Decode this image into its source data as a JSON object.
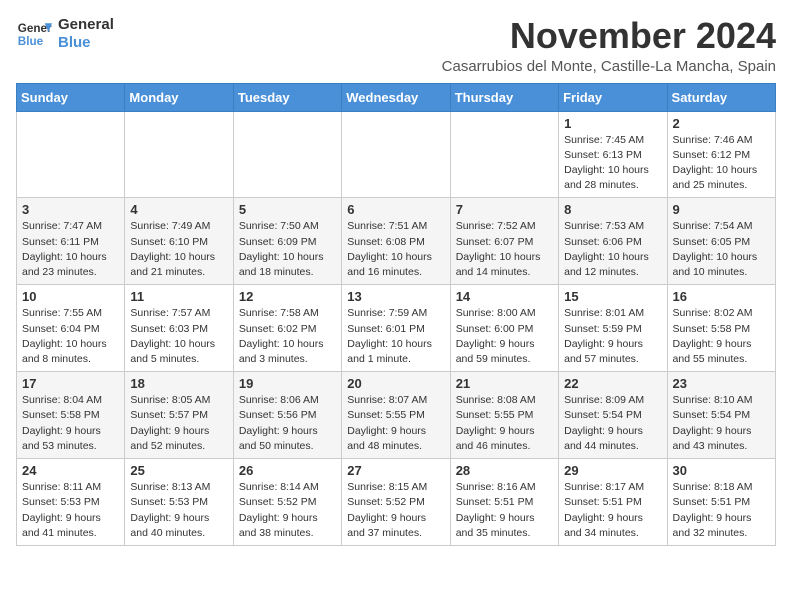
{
  "header": {
    "logo_line1": "General",
    "logo_line2": "Blue",
    "month_title": "November 2024",
    "location": "Casarrubios del Monte, Castille-La Mancha, Spain"
  },
  "days_of_week": [
    "Sunday",
    "Monday",
    "Tuesday",
    "Wednesday",
    "Thursday",
    "Friday",
    "Saturday"
  ],
  "weeks": [
    [
      {
        "day": "",
        "info": ""
      },
      {
        "day": "",
        "info": ""
      },
      {
        "day": "",
        "info": ""
      },
      {
        "day": "",
        "info": ""
      },
      {
        "day": "",
        "info": ""
      },
      {
        "day": "1",
        "info": "Sunrise: 7:45 AM\nSunset: 6:13 PM\nDaylight: 10 hours and 28 minutes."
      },
      {
        "day": "2",
        "info": "Sunrise: 7:46 AM\nSunset: 6:12 PM\nDaylight: 10 hours and 25 minutes."
      }
    ],
    [
      {
        "day": "3",
        "info": "Sunrise: 7:47 AM\nSunset: 6:11 PM\nDaylight: 10 hours and 23 minutes."
      },
      {
        "day": "4",
        "info": "Sunrise: 7:49 AM\nSunset: 6:10 PM\nDaylight: 10 hours and 21 minutes."
      },
      {
        "day": "5",
        "info": "Sunrise: 7:50 AM\nSunset: 6:09 PM\nDaylight: 10 hours and 18 minutes."
      },
      {
        "day": "6",
        "info": "Sunrise: 7:51 AM\nSunset: 6:08 PM\nDaylight: 10 hours and 16 minutes."
      },
      {
        "day": "7",
        "info": "Sunrise: 7:52 AM\nSunset: 6:07 PM\nDaylight: 10 hours and 14 minutes."
      },
      {
        "day": "8",
        "info": "Sunrise: 7:53 AM\nSunset: 6:06 PM\nDaylight: 10 hours and 12 minutes."
      },
      {
        "day": "9",
        "info": "Sunrise: 7:54 AM\nSunset: 6:05 PM\nDaylight: 10 hours and 10 minutes."
      }
    ],
    [
      {
        "day": "10",
        "info": "Sunrise: 7:55 AM\nSunset: 6:04 PM\nDaylight: 10 hours and 8 minutes."
      },
      {
        "day": "11",
        "info": "Sunrise: 7:57 AM\nSunset: 6:03 PM\nDaylight: 10 hours and 5 minutes."
      },
      {
        "day": "12",
        "info": "Sunrise: 7:58 AM\nSunset: 6:02 PM\nDaylight: 10 hours and 3 minutes."
      },
      {
        "day": "13",
        "info": "Sunrise: 7:59 AM\nSunset: 6:01 PM\nDaylight: 10 hours and 1 minute."
      },
      {
        "day": "14",
        "info": "Sunrise: 8:00 AM\nSunset: 6:00 PM\nDaylight: 9 hours and 59 minutes."
      },
      {
        "day": "15",
        "info": "Sunrise: 8:01 AM\nSunset: 5:59 PM\nDaylight: 9 hours and 57 minutes."
      },
      {
        "day": "16",
        "info": "Sunrise: 8:02 AM\nSunset: 5:58 PM\nDaylight: 9 hours and 55 minutes."
      }
    ],
    [
      {
        "day": "17",
        "info": "Sunrise: 8:04 AM\nSunset: 5:58 PM\nDaylight: 9 hours and 53 minutes."
      },
      {
        "day": "18",
        "info": "Sunrise: 8:05 AM\nSunset: 5:57 PM\nDaylight: 9 hours and 52 minutes."
      },
      {
        "day": "19",
        "info": "Sunrise: 8:06 AM\nSunset: 5:56 PM\nDaylight: 9 hours and 50 minutes."
      },
      {
        "day": "20",
        "info": "Sunrise: 8:07 AM\nSunset: 5:55 PM\nDaylight: 9 hours and 48 minutes."
      },
      {
        "day": "21",
        "info": "Sunrise: 8:08 AM\nSunset: 5:55 PM\nDaylight: 9 hours and 46 minutes."
      },
      {
        "day": "22",
        "info": "Sunrise: 8:09 AM\nSunset: 5:54 PM\nDaylight: 9 hours and 44 minutes."
      },
      {
        "day": "23",
        "info": "Sunrise: 8:10 AM\nSunset: 5:54 PM\nDaylight: 9 hours and 43 minutes."
      }
    ],
    [
      {
        "day": "24",
        "info": "Sunrise: 8:11 AM\nSunset: 5:53 PM\nDaylight: 9 hours and 41 minutes."
      },
      {
        "day": "25",
        "info": "Sunrise: 8:13 AM\nSunset: 5:53 PM\nDaylight: 9 hours and 40 minutes."
      },
      {
        "day": "26",
        "info": "Sunrise: 8:14 AM\nSunset: 5:52 PM\nDaylight: 9 hours and 38 minutes."
      },
      {
        "day": "27",
        "info": "Sunrise: 8:15 AM\nSunset: 5:52 PM\nDaylight: 9 hours and 37 minutes."
      },
      {
        "day": "28",
        "info": "Sunrise: 8:16 AM\nSunset: 5:51 PM\nDaylight: 9 hours and 35 minutes."
      },
      {
        "day": "29",
        "info": "Sunrise: 8:17 AM\nSunset: 5:51 PM\nDaylight: 9 hours and 34 minutes."
      },
      {
        "day": "30",
        "info": "Sunrise: 8:18 AM\nSunset: 5:51 PM\nDaylight: 9 hours and 32 minutes."
      }
    ]
  ]
}
